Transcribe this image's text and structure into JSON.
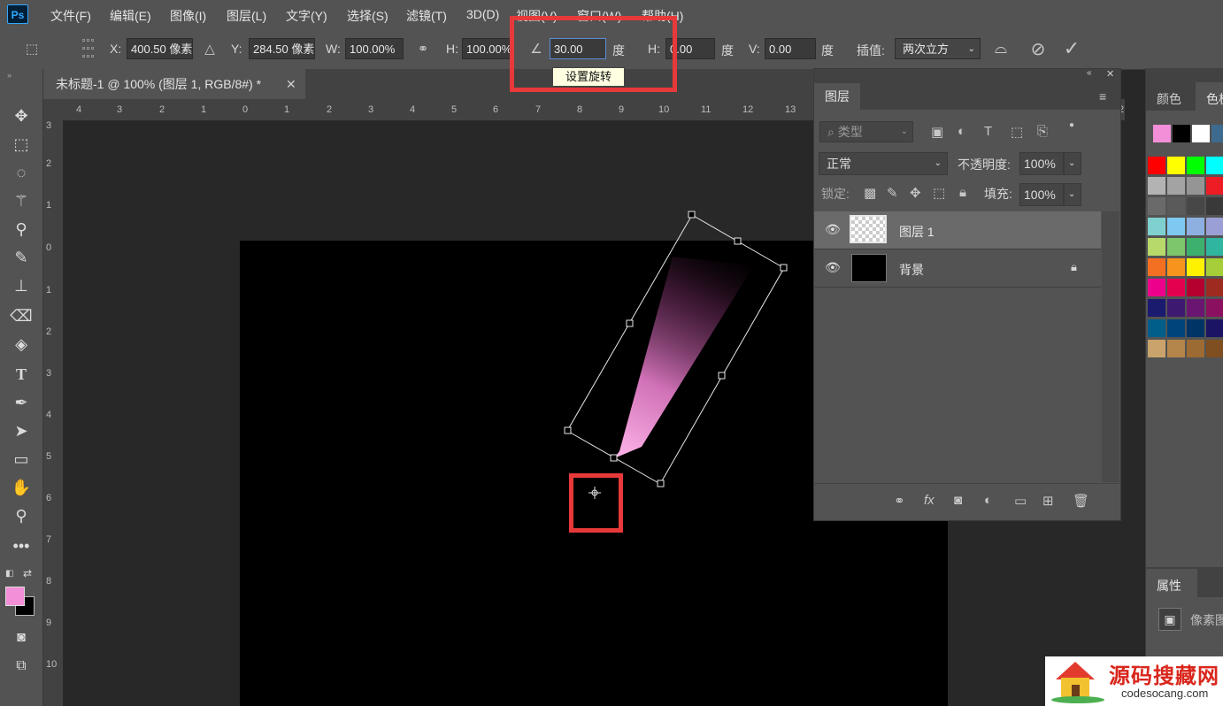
{
  "app": {
    "logo": "Ps"
  },
  "menu": [
    "文件(F)",
    "编辑(E)",
    "图像(I)",
    "图层(L)",
    "文字(Y)",
    "选择(S)",
    "滤镜(T)",
    "3D(D)",
    "视图(V)",
    "窗口(W)",
    "帮助(H)"
  ],
  "options": {
    "x_label": "X:",
    "x_value": "400.50 像素",
    "y_label": "Y:",
    "y_value": "284.50 像素",
    "w_label": "W:",
    "w_value": "100.00%",
    "h_label": "H:",
    "h_value": "100.00%",
    "angle_value": "30.00",
    "angle_unit": "度",
    "skew_h_label": "H:",
    "skew_h_value": "0.00",
    "skew_h_unit": "度",
    "skew_v_label": "V:",
    "skew_v_value": "0.00",
    "skew_v_unit": "度",
    "interp_label": "插值:",
    "interp_value": "两次立方",
    "tooltip": "设置旋转"
  },
  "document": {
    "tab_title": "未标题-1 @ 100% (图层 1, RGB/8#) *",
    "ruler_top": [
      "4",
      "3",
      "2",
      "1",
      "0",
      "1",
      "2",
      "3",
      "4",
      "5",
      "6",
      "7",
      "8",
      "9",
      "10",
      "11",
      "12",
      "13",
      "2"
    ],
    "ruler_left": [
      "3",
      "2",
      "1",
      "0",
      "1",
      "2",
      "3",
      "4",
      "5",
      "6",
      "7",
      "8",
      "9",
      "10"
    ]
  },
  "layers_panel": {
    "tab": "图层",
    "filter_placeholder": "类型",
    "blend_mode": "正常",
    "opacity_label": "不透明度:",
    "opacity_value": "100%",
    "lock_label": "锁定:",
    "fill_label": "填充:",
    "fill_value": "100%",
    "layers": [
      {
        "name": "图层 1",
        "selected": true
      },
      {
        "name": "背景",
        "locked": true
      }
    ]
  },
  "right_panel": {
    "tab_color": "颜色",
    "tab_swatches": "色板",
    "properties_tab": "属性",
    "properties_item": "像素图",
    "recent_swatches": [
      "#f28fd8",
      "#000000",
      "#ffffff",
      "#3d6b8f"
    ],
    "swatch_rows": [
      [
        "#ff0000",
        "#ffff00",
        "#00ff00",
        "#00ffff"
      ],
      [
        "#b3b3b3",
        "#a3a3a3",
        "#959595",
        "#ee1c24"
      ],
      [
        "#6a6a6a",
        "#5a5a5a",
        "#474747",
        "#393939"
      ],
      [
        "#7fd1cf",
        "#7ec9f1",
        "#8db0e0",
        "#9aa0d6"
      ],
      [
        "#b6d96a",
        "#7dc66b",
        "#3db06e",
        "#30b5a0"
      ],
      [
        "#f37022",
        "#f7941d",
        "#fff200",
        "#a6ce39"
      ],
      [
        "#ec008c",
        "#e4004f",
        "#b5002f",
        "#9e2b20"
      ],
      [
        "#1a1a6e",
        "#3d1970",
        "#6a1670",
        "#8b1060"
      ],
      [
        "#005e8a",
        "#00447c",
        "#003366",
        "#1b1464"
      ],
      [
        "#c9a36b",
        "#b5864b",
        "#9c6b34",
        "#7f4f22"
      ]
    ]
  },
  "colors": {
    "foreground": "#f28fd8",
    "background": "#000000",
    "highlight": "#e8393a"
  },
  "watermark": {
    "title": "源码搜藏网",
    "url": "codesocang.com"
  }
}
